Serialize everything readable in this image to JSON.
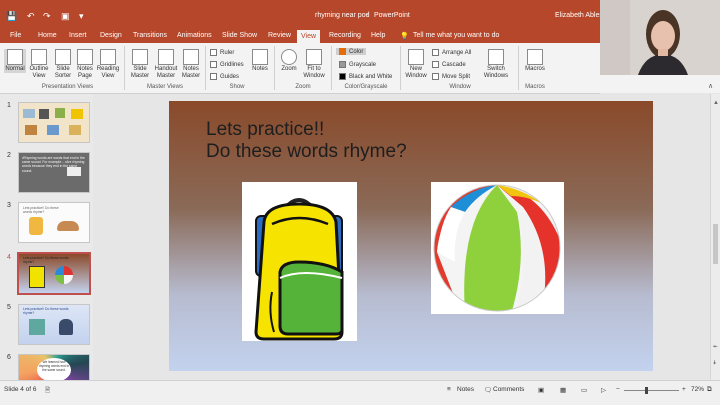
{
  "window": {
    "doc_title": "rhyming near pod",
    "app_name": "PowerPoint",
    "user_name": "Elizabeth Ables"
  },
  "tabs": [
    "File",
    "Home",
    "Insert",
    "Design",
    "Transitions",
    "Animations",
    "Slide Show",
    "Review",
    "View",
    "Recording",
    "Help"
  ],
  "active_tab": "View",
  "tell_me": "Tell me what you want to do",
  "ribbon": {
    "presentation_views": {
      "label": "Presentation Views",
      "buttons": [
        "Normal",
        "Outline View",
        "Slide Sorter",
        "Notes Page",
        "Reading View"
      ]
    },
    "master_views": {
      "label": "Master Views",
      "buttons": [
        "Slide Master",
        "Handout Master",
        "Notes Master"
      ]
    },
    "show": {
      "label": "Show",
      "checkboxes": [
        "Ruler",
        "Gridlines",
        "Guides"
      ],
      "notes": "Notes"
    },
    "zoom": {
      "label": "Zoom",
      "buttons": [
        "Zoom",
        "Fit to Window"
      ]
    },
    "color": {
      "label": "Color/Grayscale",
      "options": [
        "Color",
        "Grayscale",
        "Black and White"
      ]
    },
    "window": {
      "label": "Window",
      "new_window": "New Window",
      "small": [
        "Arrange All",
        "Cascade",
        "Move Split"
      ],
      "switch_windows": "Switch Windows"
    },
    "macros": {
      "label": "Macros",
      "button": "Macros"
    }
  },
  "thumbnails": [
    {
      "num": "1",
      "text": ""
    },
    {
      "num": "2",
      "text": "•Rhyming words are words that end in the same sound. For example... •Are rhyming words because they end in the same sound."
    },
    {
      "num": "3",
      "text": "Lets practice!! Do these words rhyme?"
    },
    {
      "num": "4",
      "text": "Lets practice!! Do these words rhyme?"
    },
    {
      "num": "5",
      "text": "Lets practice!! Do these words rhyme?"
    },
    {
      "num": "6",
      "text": "We learned how rhyming words end in the same sound."
    }
  ],
  "selected_slide": 4,
  "slide": {
    "line1": "Lets practice!!",
    "line2": "Do these words rhyme?"
  },
  "status": {
    "slide_of": "Slide 4 of 6",
    "notes": "Notes",
    "comments": "Comments",
    "zoom": "72%"
  },
  "colors": {
    "accent": "#b7472a",
    "slide_top": "#8a4a2a",
    "slide_bottom": "#c3d2ee"
  }
}
